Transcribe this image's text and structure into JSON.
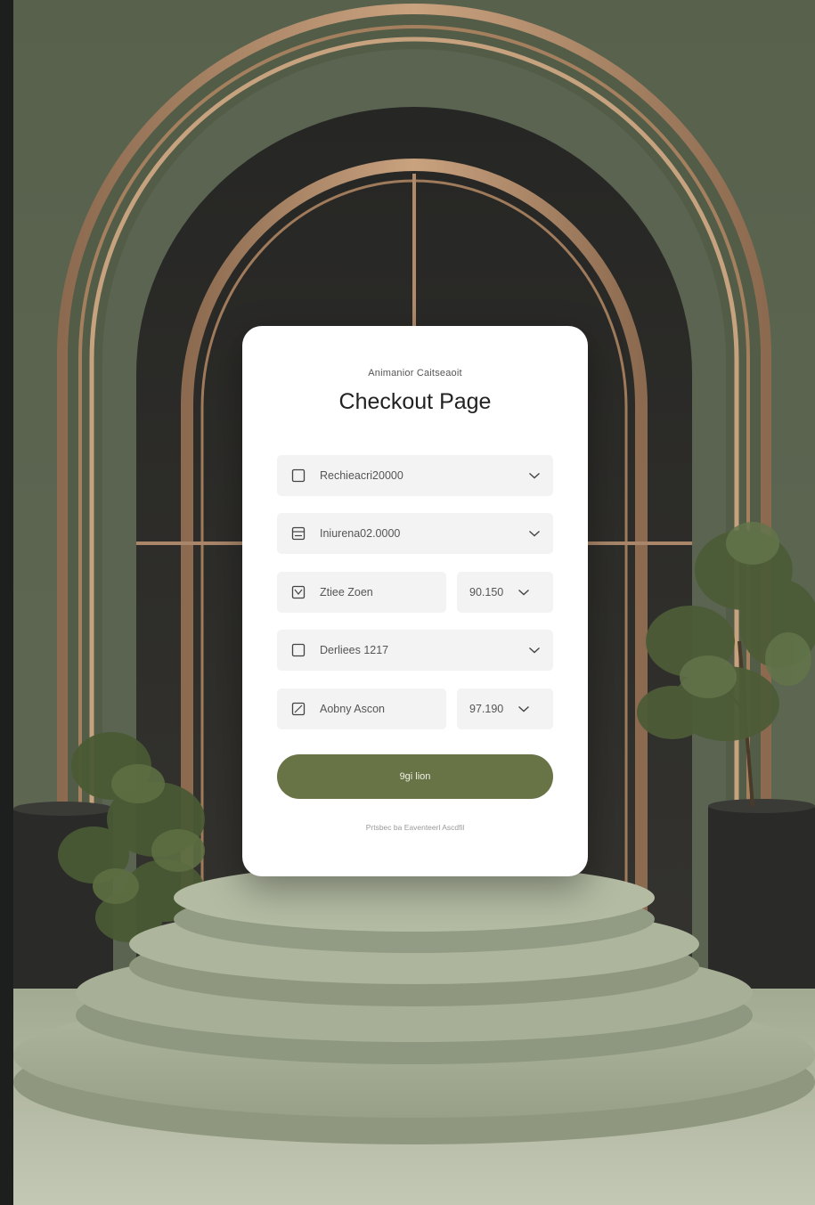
{
  "checkout": {
    "eyebrow": "Animanior Caitseaoit",
    "title": "Checkout Page",
    "fields": [
      {
        "label": "Rechieacri20000",
        "icon": "checkbox-icon"
      },
      {
        "label": "Iniurena02.0000",
        "icon": "card-icon"
      },
      {
        "label": "Ztiee Zoen",
        "value": "90.150",
        "icon": "checked-box-icon"
      },
      {
        "label": "Derliees 1217",
        "icon": "checkbox-icon"
      },
      {
        "label": "Aobny Ascon",
        "value": "97.190",
        "icon": "edit-box-icon"
      }
    ],
    "submit_label": "9gi lion",
    "footnote": "Prtsbec ba Eaventeerl Ascdfil"
  },
  "colors": {
    "wall": "#5b6550",
    "arch_wood": "#b48e6c",
    "niche": "#2b2a27",
    "button": "#697446",
    "podium": "#a5ae94"
  }
}
